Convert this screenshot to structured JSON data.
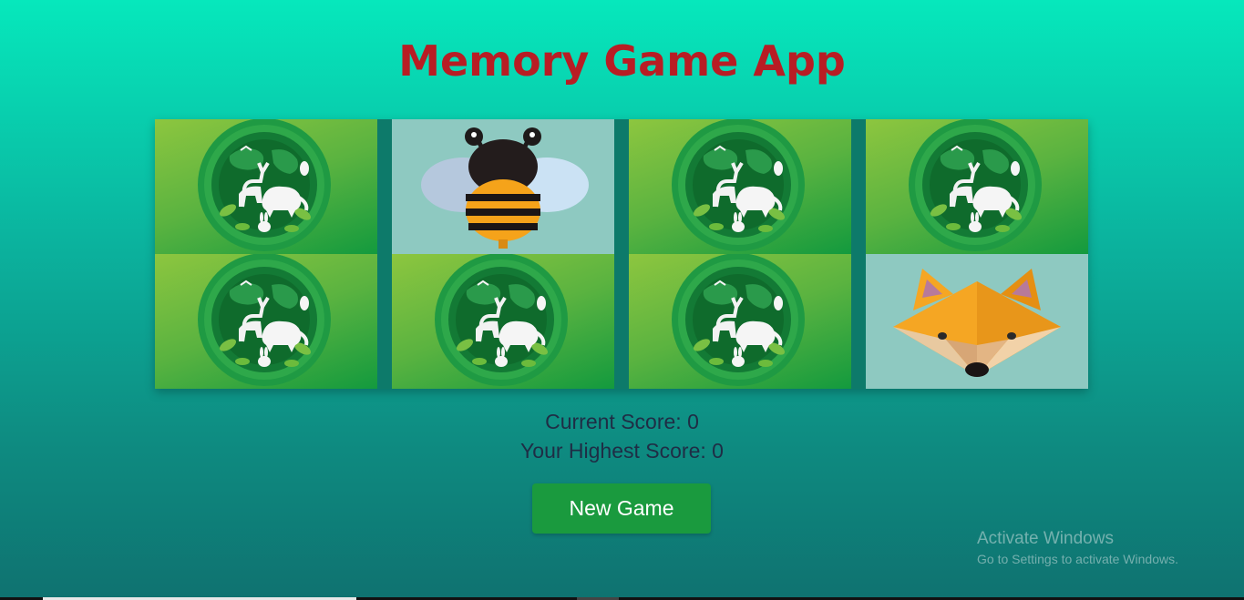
{
  "title": "Memory Game App",
  "cards": [
    {
      "state": "hidden",
      "icon": "wildlife-card-back"
    },
    {
      "state": "revealed",
      "icon": "bee"
    },
    {
      "state": "hidden",
      "icon": "wildlife-card-back"
    },
    {
      "state": "hidden",
      "icon": "wildlife-card-back"
    },
    {
      "state": "hidden",
      "icon": "wildlife-card-back"
    },
    {
      "state": "hidden",
      "icon": "wildlife-card-back"
    },
    {
      "state": "hidden",
      "icon": "wildlife-card-back"
    },
    {
      "state": "revealed",
      "icon": "fox"
    }
  ],
  "scores": {
    "current": "Current Score: 0",
    "highest": "Your Highest Score: 0"
  },
  "new_game_label": "New Game",
  "watermark": {
    "title": "Activate Windows",
    "subtitle": "Go to Settings to activate Windows."
  },
  "colors": {
    "title": "#b81d24",
    "button": "#1a9a3e",
    "score_text": "#1f2d45"
  }
}
